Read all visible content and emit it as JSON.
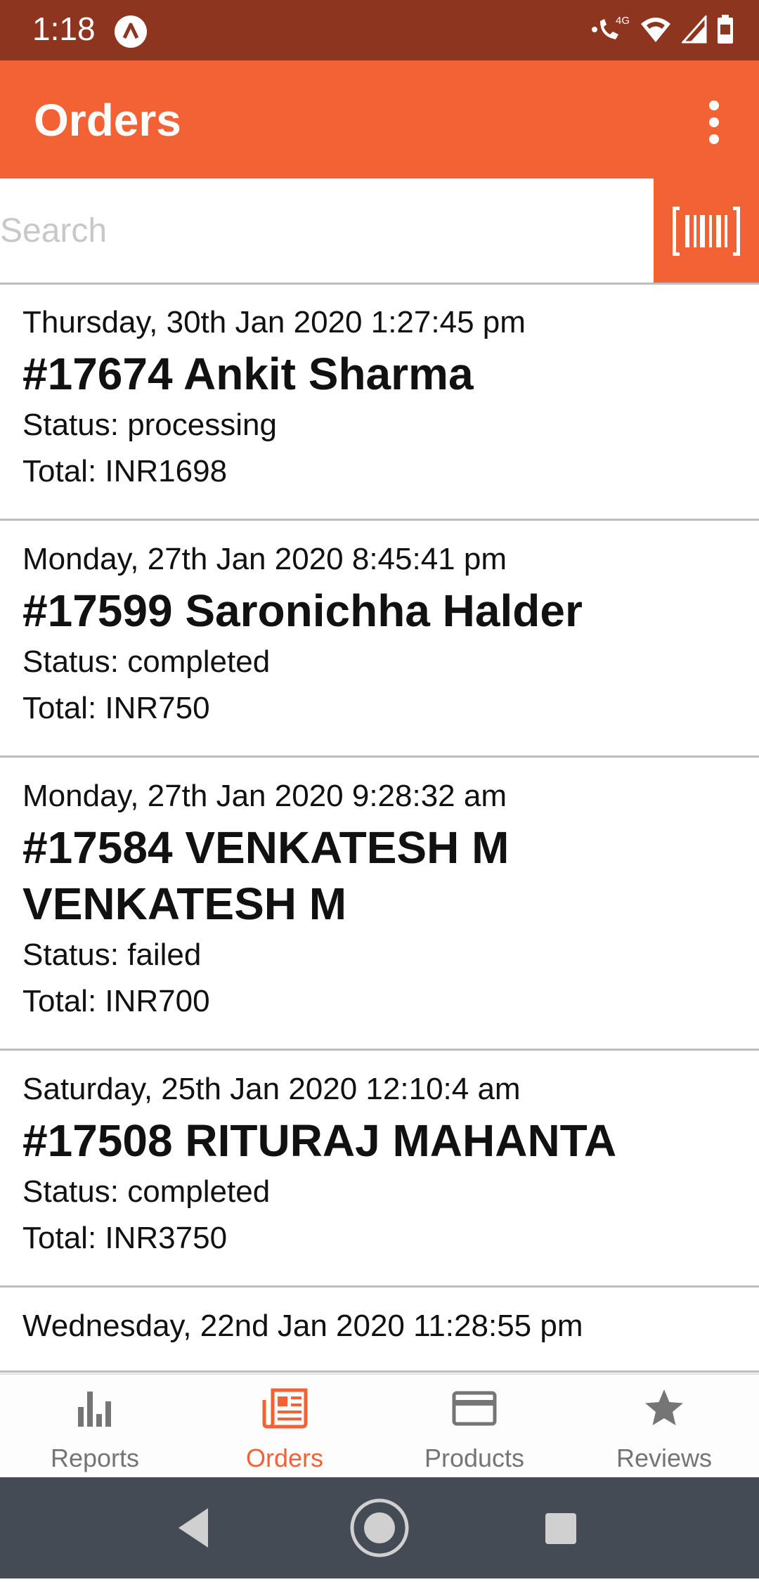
{
  "status_bar": {
    "time": "1:18",
    "network": "4G"
  },
  "app_bar": {
    "title": "Orders"
  },
  "search": {
    "placeholder": "Search",
    "value": ""
  },
  "orders": [
    {
      "date": "Thursday, 30th Jan 2020 1:27:45 pm",
      "title": "#17674 Ankit Sharma",
      "status": "Status: processing",
      "total": "Total: INR1698"
    },
    {
      "date": "Monday, 27th Jan 2020 8:45:41 pm",
      "title": "#17599 Saronichha Halder",
      "status": "Status: completed",
      "total": "Total: INR750"
    },
    {
      "date": "Monday, 27th Jan 2020 9:28:32 am",
      "title": "#17584 VENKATESH M VENKATESH M",
      "status": "Status: failed",
      "total": "Total: INR700"
    },
    {
      "date": "Saturday, 25th Jan 2020 12:10:4 am",
      "title": "#17508 RITURAJ MAHANTA",
      "status": "Status: completed",
      "total": "Total: INR3750"
    },
    {
      "date": "Wednesday, 22nd Jan 2020 11:28:55 pm",
      "title": "",
      "status": "",
      "total": ""
    }
  ],
  "bottom_nav": {
    "items": [
      {
        "label": "Reports",
        "icon": "bar-chart-icon"
      },
      {
        "label": "Orders",
        "icon": "orders-icon",
        "active": true
      },
      {
        "label": "Products",
        "icon": "card-icon"
      },
      {
        "label": "Reviews",
        "icon": "star-icon"
      }
    ]
  },
  "colors": {
    "accent": "#f26234",
    "status_bar": "#8d351e",
    "nav_inactive": "#757575",
    "system_nav": "#454b54"
  }
}
